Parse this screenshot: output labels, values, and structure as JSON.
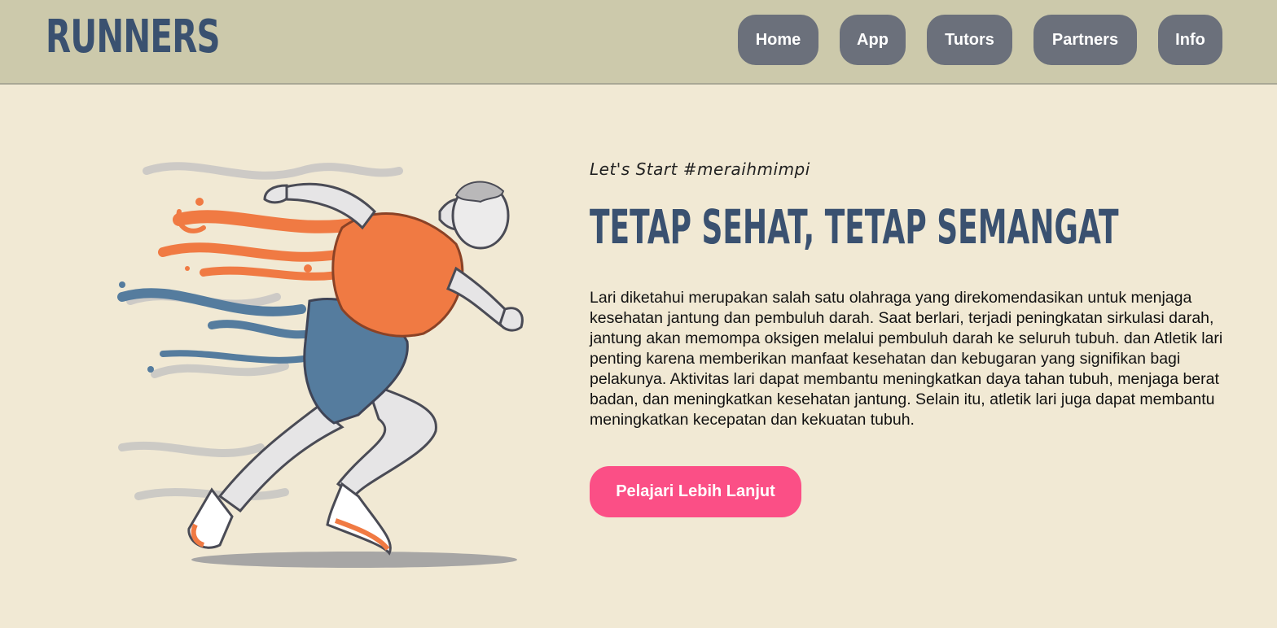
{
  "header": {
    "logo": "RUNNERS",
    "nav": [
      "Home",
      "App",
      "Tutors",
      "Partners",
      "Info"
    ]
  },
  "hero": {
    "tagline": "Let's Start #meraihmimpi",
    "headline": "TETAP SEHAT, TETAP SEMANGAT",
    "body": "Lari diketahui merupakan salah satu olahraga yang direkomendasikan untuk menjaga kesehatan jantung dan pembuluh darah. Saat berlari, terjadi peningkatan sirkulasi darah, jantung akan memompa oksigen melalui pembuluh darah ke seluruh tubuh. dan Atletik lari penting karena memberikan manfaat kesehatan dan kebugaran yang signifikan bagi pelakunya. Aktivitas lari dapat membantu meningkatkan daya tahan tubuh, menjaga berat badan, dan meningkatkan kesehatan jantung. Selain itu, atletik lari juga dapat membantu meningkatkan kecepatan dan kekuatan tubuh.",
    "cta": "Pelajari Lebih Lanjut",
    "illustration": "runner-illustration"
  },
  "colors": {
    "header_bg": "#ccc9ab",
    "page_bg": "#f1e9d4",
    "brand": "#3a5170",
    "nav_button": "#6b707b",
    "cta": "#fb4f86",
    "accent_orange": "#f07a43",
    "accent_blue": "#557c9e"
  }
}
